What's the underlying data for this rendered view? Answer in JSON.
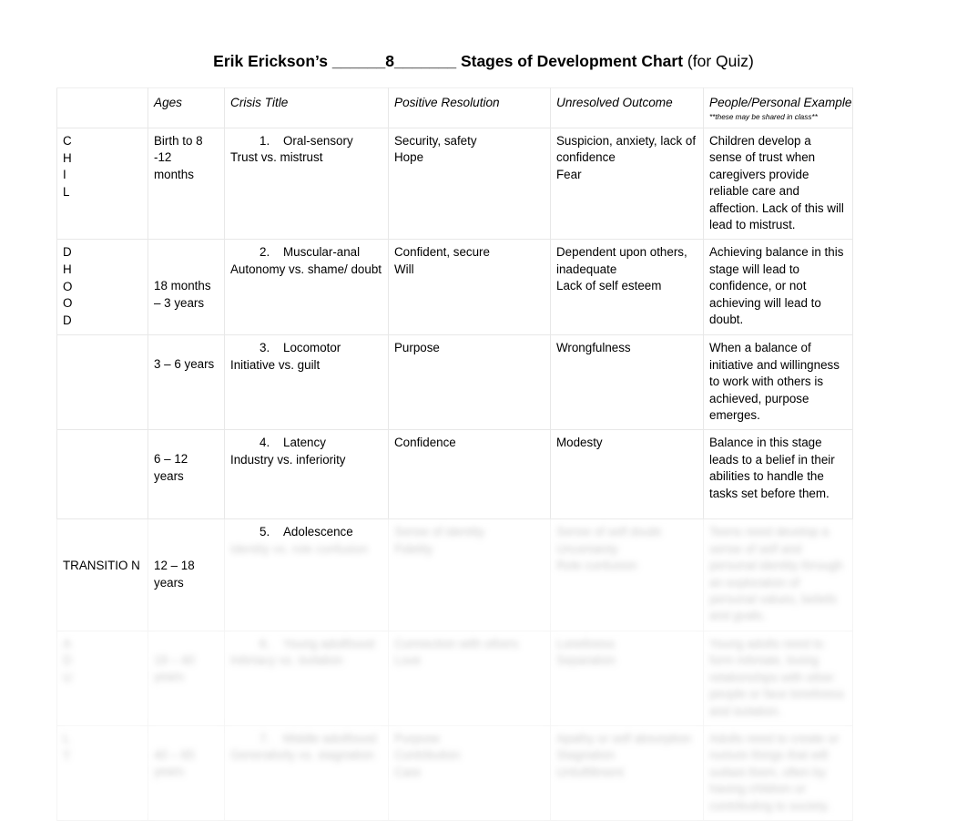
{
  "document": {
    "title_bold_part1": "Erik Erickson’s ______8_______ Stages of Development Chart",
    "title_normal_part2": "(for Quiz)"
  },
  "table": {
    "headers": {
      "stage": "",
      "ages": "Ages",
      "crisis_title": "Crisis Title",
      "positive_resolution": "Positive Resolution",
      "unresolved_outcome": "Unresolved Outcome",
      "people_personal_example": "People/Personal Example",
      "people_personal_example_note": "**these may be shared in class**"
    },
    "stage_labels": {
      "childhood": "CHILDHOOD",
      "transition": "TRANSITION"
    },
    "rows": [
      {
        "number": "1.",
        "stage_letters": [
          "C",
          "H",
          "I",
          "L"
        ],
        "ages": [
          "Birth to 8",
          "-12",
          "months"
        ],
        "crisis_name": "Oral-sensory",
        "crisis_subtitle": "Trust vs. mistrust",
        "positive_resolution": [
          "Security, safety",
          "Hope"
        ],
        "unresolved_outcome": [
          "Suspicion, anxiety, lack of",
          "confidence",
          "Fear"
        ],
        "people_example": "Children develop a sense of trust when caregivers provide reliable care and affection. Lack of this will lead to mistrust.",
        "legible": true
      },
      {
        "number": "2.",
        "stage_letters": [
          "D",
          "H",
          "O",
          "O",
          "D"
        ],
        "ages": [
          "18 months",
          "– 3 years"
        ],
        "crisis_name": "Muscular-anal",
        "crisis_subtitle": "Autonomy vs. shame/ doubt",
        "positive_resolution": [
          "Confident, secure",
          "Will"
        ],
        "unresolved_outcome": [
          "Dependent upon others,",
          "inadequate",
          "Lack of self esteem"
        ],
        "people_example": "Achieving balance in this stage will lead to confidence, or not achieving will lead to doubt.",
        "legible": true
      },
      {
        "number": "3.",
        "stage_letters": [],
        "ages": [
          "3 – 6 years"
        ],
        "crisis_name": "Locomotor",
        "crisis_subtitle": "Initiative vs. guilt",
        "positive_resolution": [
          "Purpose"
        ],
        "unresolved_outcome": [
          "Wrongfulness"
        ],
        "people_example": "When a balance of initiative and willingness to work with others is achieved, purpose emerges.",
        "legible": true
      },
      {
        "number": "4.",
        "stage_letters": [],
        "ages": [
          "6 – 12",
          "years"
        ],
        "crisis_name": "Latency",
        "crisis_subtitle": "Industry vs. inferiority",
        "positive_resolution": [
          "Confidence"
        ],
        "unresolved_outcome": [
          "Modesty"
        ],
        "people_example": "Balance in this stage leads to a belief in their abilities to handle the tasks set before them.",
        "legible": true
      },
      {
        "number": "5.",
        "stage_letters": [],
        "stage_text": "TRANSITIO N",
        "ages": [
          "12 – 18",
          "years"
        ],
        "crisis_name": "Adolescence",
        "crisis_subtitle": "Identity vs. role confusion",
        "positive_resolution": [
          "Sense of identity",
          "Fidelity"
        ],
        "unresolved_outcome": [
          "Sense of self doubt",
          "Uncertainty",
          "Role confusion"
        ],
        "people_example": "Teens need develop a sense of self and personal identity through an exploration of personal values, beliefs and goals.",
        "legible": false
      },
      {
        "number": "6.",
        "stage_letters": [],
        "ages": [
          "19 – 40",
          "years"
        ],
        "crisis_name": "Young adulthood",
        "crisis_subtitle": "Intimacy vs. isolation",
        "positive_resolution": [
          "Connection with others",
          "Love"
        ],
        "unresolved_outcome": [
          "Loneliness",
          "Separation"
        ],
        "people_example": "Young adults need to form intimate, loving relationships with other people or face loneliness and isolation.",
        "legible": false
      },
      {
        "number": "7.",
        "stage_letters": [],
        "ages": [
          "40 – 65",
          "years"
        ],
        "crisis_name": "Middle adulthood",
        "crisis_subtitle": "Generativity vs. stagnation",
        "positive_resolution": [
          "Purpose",
          "Contribution",
          "Care"
        ],
        "unresolved_outcome": [
          "Apathy or self absorption",
          "Stagnation",
          "Unfulfillment"
        ],
        "people_example": "Adults need to create or nurture things that will outlast them, often by having children or contributing to society.",
        "legible": false
      }
    ]
  }
}
